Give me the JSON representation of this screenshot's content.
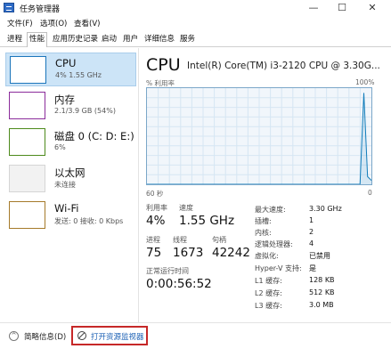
{
  "window": {
    "title": "任务管理器",
    "minimize": "—",
    "maximize": "☐",
    "close": "✕"
  },
  "menu": [
    "文件(F)",
    "选项(O)",
    "查看(V)"
  ],
  "tabs": [
    "进程",
    "性能",
    "应用历史记录",
    "启动",
    "用户",
    "详细信息",
    "服务"
  ],
  "active_tab": "性能",
  "sidebar": [
    {
      "name": "CPU",
      "sub": "4% 1.55 GHz",
      "color": "#1b75bb"
    },
    {
      "name": "内存",
      "sub": "2.1/3.9 GB (54%)",
      "color": "#8b2c9b"
    },
    {
      "name": "磁盘 0 (C: D: E:)",
      "sub": "6%",
      "color": "#4d8a1b"
    },
    {
      "name": "以太网",
      "sub": "未连接",
      "color": "#a0a0a0"
    },
    {
      "name": "Wi-Fi",
      "sub": "发送: 0 接收: 0 Kbps",
      "color": "#a57a2a"
    }
  ],
  "main": {
    "title": "CPU",
    "model": "Intel(R) Core(TM) i3-2120 CPU @ 3.30G...",
    "graph_label_left": "% 利用率",
    "graph_label_right": "100%",
    "time_label": "60 秒",
    "zero_label": "0",
    "graph_points": [
      0,
      0,
      0,
      0,
      0,
      0,
      0,
      0,
      0,
      0,
      0,
      0,
      0,
      0,
      0,
      0,
      0,
      0,
      0,
      0,
      0,
      0,
      0,
      0,
      0,
      0,
      0,
      0,
      0,
      0,
      0,
      0,
      0,
      0,
      0,
      0,
      0,
      0,
      0,
      0,
      0,
      0,
      0,
      0,
      0,
      0,
      0,
      0,
      0,
      0,
      0,
      0,
      0,
      0,
      0,
      0,
      0,
      95,
      8,
      4
    ],
    "stats": {
      "util_label": "利用率",
      "util_value": "4%",
      "speed_label": "速度",
      "speed_value": "1.55 GHz",
      "proc_label": "进程",
      "proc_value": "75",
      "thread_label": "线程",
      "thread_value": "1673",
      "handle_label": "句柄",
      "handle_value": "42242",
      "uptime_label": "正常运行时间",
      "uptime_value": "0:00:56:52"
    },
    "specs": [
      {
        "k": "最大速度:",
        "v": "3.30 GHz"
      },
      {
        "k": "插槽:",
        "v": "1"
      },
      {
        "k": "内核:",
        "v": "2"
      },
      {
        "k": "逻辑处理器:",
        "v": "4"
      },
      {
        "k": "虚拟化:",
        "v": "已禁用"
      },
      {
        "k": "Hyper-V 支持:",
        "v": "是"
      },
      {
        "k": "L1 缓存:",
        "v": "128 KB"
      },
      {
        "k": "L2 缓存:",
        "v": "512 KB"
      },
      {
        "k": "L3 缓存:",
        "v": "3.0 MB"
      }
    ]
  },
  "bottom": {
    "collapse_glyph": "^",
    "less_details": "简略信息(D)",
    "resource_monitor": "打开资源监视器"
  }
}
